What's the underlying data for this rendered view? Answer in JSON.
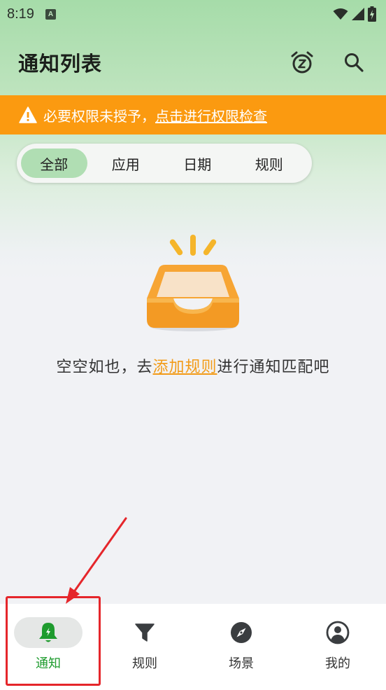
{
  "status_bar": {
    "time": "8:19",
    "app_icon_letter": "A"
  },
  "app_bar": {
    "title": "通知列表",
    "actions": [
      {
        "icon": "snooze-alarm-icon"
      },
      {
        "icon": "search-icon"
      }
    ]
  },
  "banner": {
    "icon": "warning-icon",
    "text": "必要权限未授予，",
    "link": "点击进行权限检查",
    "background": "#fb9a10"
  },
  "tabs": {
    "items": [
      {
        "label": "全部",
        "active": true
      },
      {
        "label": "应用",
        "active": false
      },
      {
        "label": "日期",
        "active": false
      },
      {
        "label": "规则",
        "active": false
      }
    ],
    "active_color": "#b0deb3"
  },
  "empty_state": {
    "illustration": "empty-inbox-icon",
    "text_before": "空空如也，去",
    "link": "添加规则",
    "text_after": "进行通知匹配吧",
    "link_color": "#f29b17"
  },
  "bottom_nav": {
    "items": [
      {
        "label": "通知",
        "icon": "bell-icon",
        "active": true
      },
      {
        "label": "规则",
        "icon": "filter-icon",
        "active": false
      },
      {
        "label": "场景",
        "icon": "compass-icon",
        "active": false
      },
      {
        "label": "我的",
        "icon": "profile-icon",
        "active": false
      }
    ],
    "active_color": "#1e9b2e"
  },
  "annotation": {
    "highlight_color": "#e5262b"
  }
}
